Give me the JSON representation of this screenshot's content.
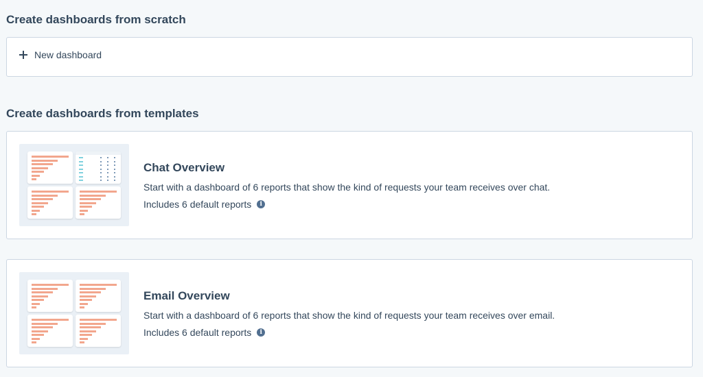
{
  "scratch": {
    "heading": "Create dashboards from scratch",
    "new_dashboard_label": "New dashboard",
    "plus_icon": "plus-icon"
  },
  "templates": {
    "heading": "Create dashboards from templates",
    "items": [
      {
        "title": "Chat Overview",
        "description": "Start with a dashboard of 6 reports that show the kind of requests your team receives over chat.",
        "includes": "Includes 6 default reports",
        "info_icon": "info-icon",
        "thumbnail_icon": "dashboard-preview-icon"
      },
      {
        "title": "Email Overview",
        "description": "Start with a dashboard of 6 reports that show the kind of requests your team receives over email.",
        "includes": "Includes 6 default reports",
        "info_icon": "info-icon",
        "thumbnail_icon": "dashboard-preview-icon"
      }
    ]
  },
  "colors": {
    "text": "#33475b",
    "border": "#cbd6e2",
    "bar": "#f2a68d",
    "background": "#f5f8fa"
  }
}
